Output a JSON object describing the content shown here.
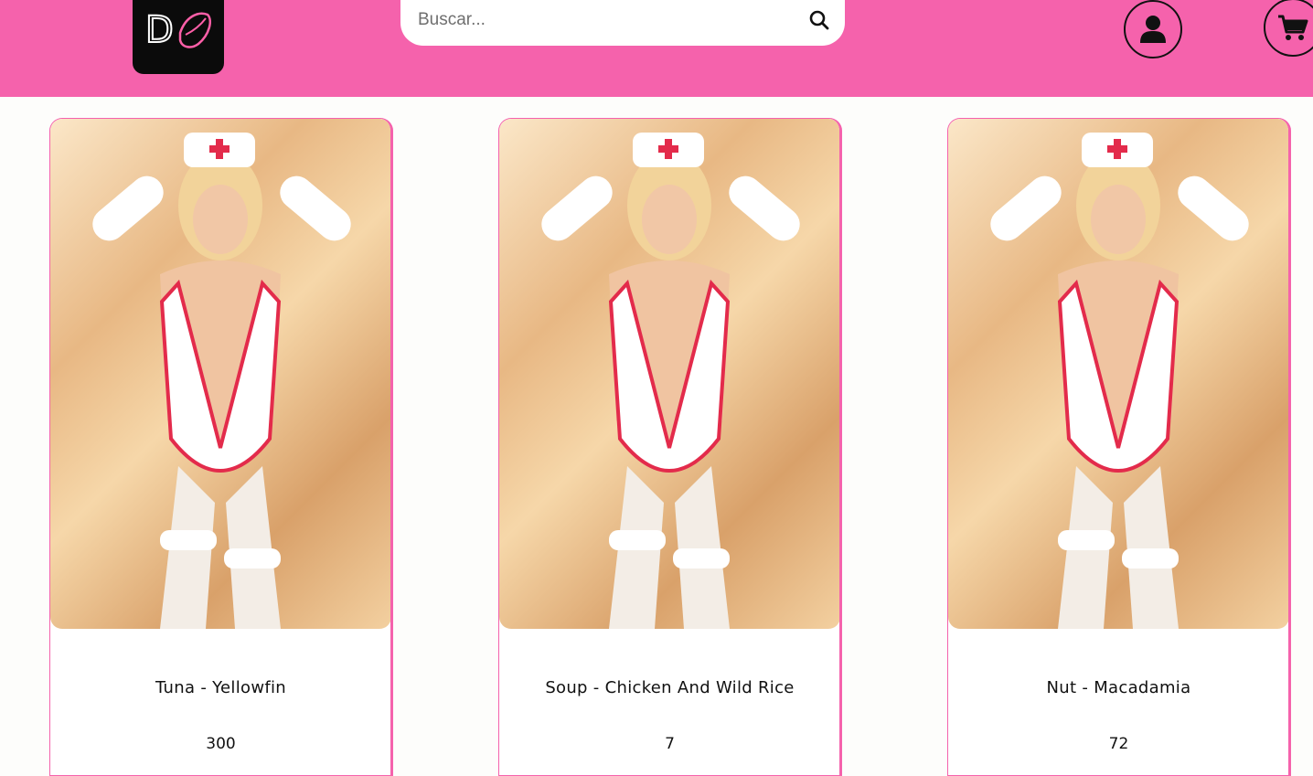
{
  "header": {
    "logo_letter": "D",
    "search": {
      "placeholder": "Buscar..."
    },
    "icons": {
      "search": "search-icon",
      "user": "user-icon",
      "cart": "cart-icon",
      "logo": "lips-icon"
    }
  },
  "colors": {
    "header_bg": "#f562ac",
    "card_border": "#f562ac",
    "logo_bg": "#0b0b0b"
  },
  "products": [
    {
      "name": "Tuna - Yellowfin",
      "price": "300"
    },
    {
      "name": "Soup - Chicken And Wild Rice",
      "price": "7"
    },
    {
      "name": "Nut - Macadamia",
      "price": "72"
    }
  ]
}
